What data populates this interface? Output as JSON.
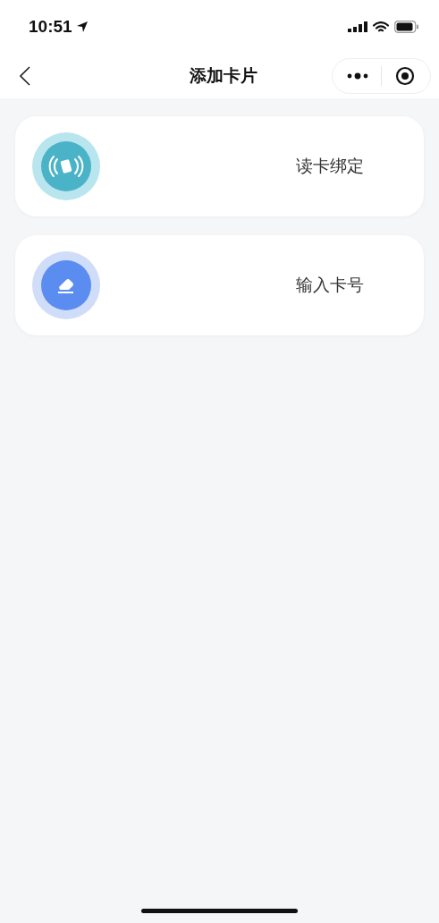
{
  "status_bar": {
    "time": "10:51"
  },
  "nav": {
    "title": "添加卡片"
  },
  "options": [
    {
      "kind": "nfc",
      "label": "读卡绑定"
    },
    {
      "kind": "edit",
      "label": "输入卡号"
    }
  ]
}
